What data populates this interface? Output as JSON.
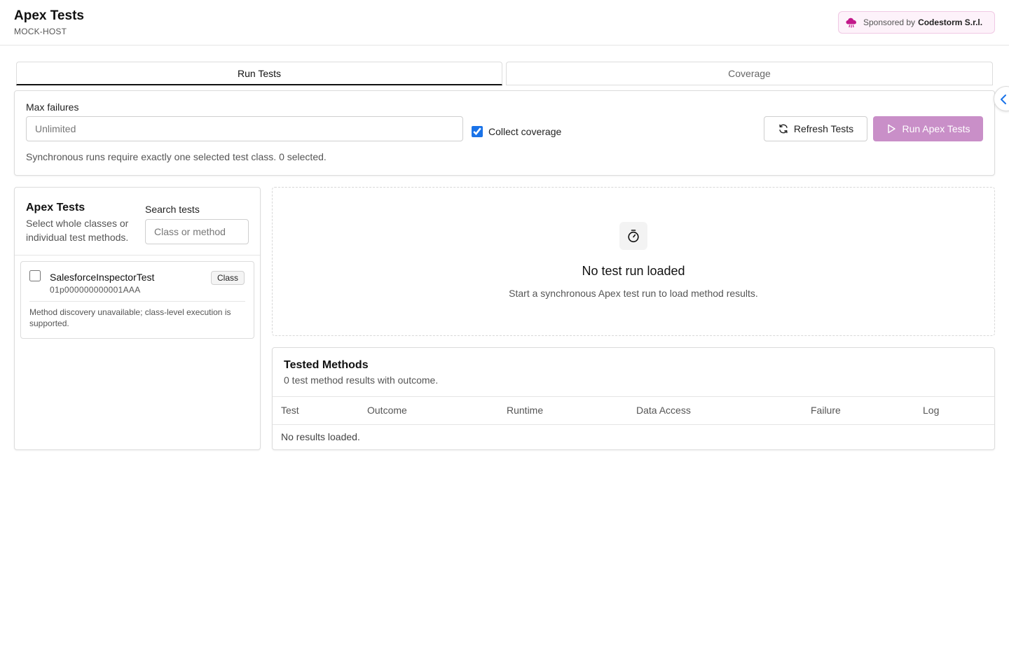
{
  "header": {
    "title": "Apex Tests",
    "host": "MOCK-HOST",
    "sponsor": {
      "prefix": "Sponsored by",
      "brand": "Codestorm S.r.l.",
      "icon": "cloud-icon",
      "accent": "#c2188a"
    }
  },
  "tabs": [
    {
      "label": "Run Tests",
      "active": true
    },
    {
      "label": "Coverage",
      "active": false
    }
  ],
  "settings": {
    "max_failures_label": "Max failures",
    "max_failures_placeholder": "Unlimited",
    "collect_coverage_label": "Collect coverage",
    "collect_coverage_checked": true,
    "refresh_label": "Refresh Tests",
    "refresh_icon": "refresh-icon",
    "run_label": "Run Apex Tests",
    "run_icon": "play-icon",
    "run_button_color": "#c98fc8",
    "run_disabled": true,
    "sync_note": "Synchronous runs require exactly one selected test class. 0 selected."
  },
  "test_list": {
    "title": "Apex Tests",
    "description": "Select whole classes or individual test methods.",
    "search_label": "Search tests",
    "search_placeholder": "Class or method",
    "items": [
      {
        "name": "SalesforceInspectorTest",
        "id": "01p000000000001AAA",
        "badge": "Class",
        "checked": false,
        "note": "Method discovery unavailable; class-level execution is supported."
      }
    ]
  },
  "empty_state": {
    "icon": "stopwatch-icon",
    "title": "No test run loaded",
    "description": "Start a synchronous Apex test run to load method results."
  },
  "methods": {
    "title": "Tested Methods",
    "subtitle": "0 test method results with outcome.",
    "columns": [
      "Test",
      "Outcome",
      "Runtime",
      "Data Access",
      "Failure",
      "Log"
    ],
    "empty_text": "No results loaded."
  },
  "side_handle": {
    "icon": "chevron-left-icon",
    "color": "#1a73e8"
  }
}
